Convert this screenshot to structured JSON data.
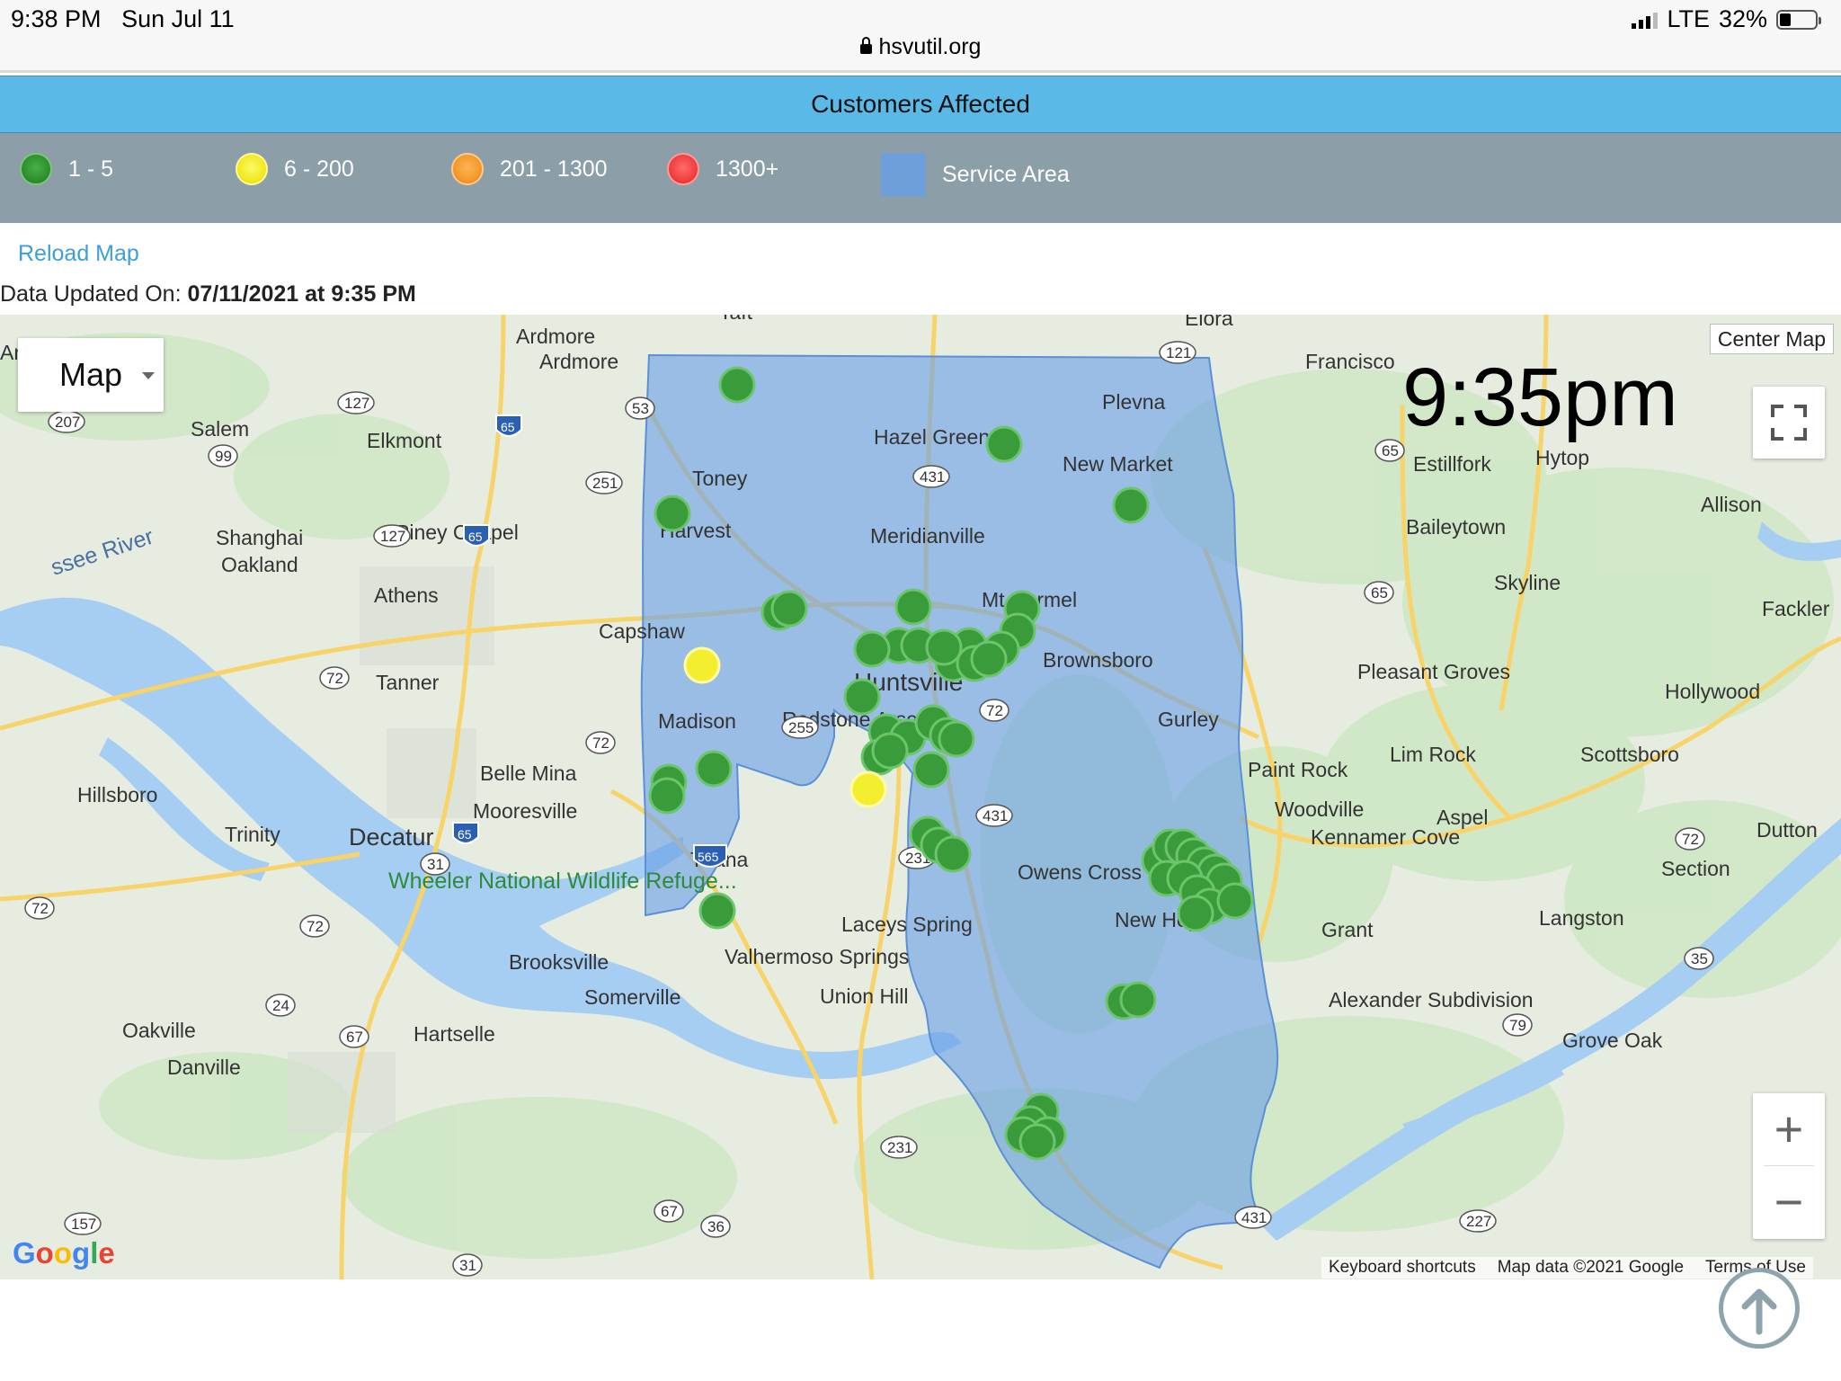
{
  "status_bar": {
    "time": "9:38 PM",
    "date": "Sun Jul 11",
    "network": "LTE",
    "battery": "32%"
  },
  "browser": {
    "url": "hsvutil.org"
  },
  "header": {
    "title": "Customers Affected"
  },
  "legend": {
    "items": [
      {
        "label": "1 - 5",
        "color": "#3c9b3c"
      },
      {
        "label": "6 - 200",
        "color": "#f4ef2e"
      },
      {
        "label": "201 - 1300",
        "color": "#f39a2b"
      },
      {
        "label": "1300+",
        "color": "#f04040"
      }
    ],
    "service_area": {
      "label": "Service Area",
      "color": "#6f9fd8"
    }
  },
  "controls": {
    "reload": "Reload Map",
    "updated_prefix": "Data Updated On:",
    "updated_value": "07/11/2021 at 9:35 PM"
  },
  "map": {
    "map_type": "Map",
    "center_button": "Center Map",
    "overlay_time": "9:35pm",
    "zoom_in": "+",
    "zoom_out": "−",
    "attribution": {
      "shortcuts": "Keyboard shortcuts",
      "data": "Map data ©2021 Google",
      "terms": "Terms of Use"
    },
    "places": [
      "Ardmore",
      "Ardmore",
      "Taft",
      "Elora",
      "Francisco",
      "Salem",
      "Elkmont",
      "Plevna",
      "Hazel Green",
      "New Market",
      "Estillfork",
      "Hytop",
      "Toney",
      "Harvest",
      "Meridianville",
      "Allison",
      "Baileytown",
      "Shanghai",
      "Oakland",
      "Piney Chapel",
      "Athens",
      "Skyline",
      "Fackler",
      "Mt Carmel",
      "Capshaw",
      "Brownsboro",
      "Tanner",
      "Madison",
      "Huntsville",
      "Redstone Arsenal",
      "Pleasant Groves",
      "Hollywood",
      "Gurley",
      "Lim Rock",
      "Scottsboro",
      "Paint Rock",
      "Hillsboro",
      "Belle Mina",
      "Mooresville",
      "Woodville",
      "Aspel",
      "Kennamer Cove",
      "Dutton",
      "Trinity",
      "Decatur",
      "Triana",
      "Owens Cross Roads",
      "Section",
      "Wheeler National Wildlife Refuge...",
      "Laceys Spring",
      "New Hope",
      "Grant",
      "Langston",
      "Brooksville",
      "Valhermoso Springs",
      "Union Hill",
      "Somerville",
      "Alexander Subdivision",
      "Oakville",
      "Hartselle",
      "Grove Oak",
      "Danville",
      "Anderson",
      "Tennessee River"
    ],
    "outage_markers": {
      "count_1_5": 54,
      "count_6_200": 2
    },
    "colors": {
      "service_area": "#6b9fe6",
      "land": "#e7ece1",
      "water": "#a6cdf2",
      "highway": "#f7d36a"
    }
  }
}
